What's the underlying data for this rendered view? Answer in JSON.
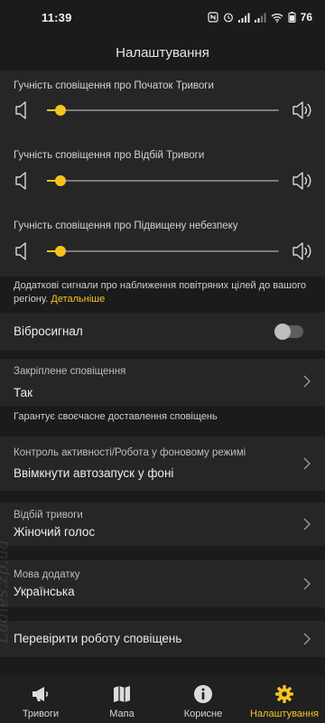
{
  "status_bar": {
    "time": "11:39",
    "battery": "76"
  },
  "header": {
    "title": "Налаштування"
  },
  "volume_sliders": [
    {
      "title": "Гучність сповіщення про Початок Тривоги",
      "level": 0.06
    },
    {
      "title": "Гучність сповіщення про Відбій Тривоги",
      "level": 0.06
    },
    {
      "title": "Гучність сповіщення про Підвищену небезпеку",
      "level": 0.06
    }
  ],
  "extra_signals": {
    "text": "Додаткові сигнали про наближення повітряних цілей до вашого регіону.",
    "link": "Детальніше"
  },
  "vibration": {
    "label": "Вібросигнал",
    "enabled": false
  },
  "pinned_notification": {
    "label": "Закріплене сповіщення",
    "value": "Так",
    "hint": "Гарантує своєчасне доставлення сповіщень"
  },
  "background_activity": {
    "label": "Контроль активності/Робота у фоновому режимі",
    "value": "Ввімкнути автозапуск у фоні"
  },
  "all_clear": {
    "label": "Відбій тривоги",
    "value": "Жіночий голос"
  },
  "language": {
    "label": "Мова додатку",
    "value": "Українська"
  },
  "check_notifications": {
    "label": "Перевірити роботу сповіщень"
  },
  "nav": {
    "items": [
      {
        "label": "Тривоги",
        "icon": "megaphone-icon"
      },
      {
        "label": "Мапа",
        "icon": "map-icon"
      },
      {
        "label": "Корисне",
        "icon": "info-icon"
      },
      {
        "label": "Налаштування",
        "icon": "gear-icon"
      }
    ],
    "active": 3
  },
  "watermark": "Ladies.zp.ua",
  "colors": {
    "accent": "#f4c51f",
    "background": "#1b1b1b",
    "card": "#262626"
  }
}
